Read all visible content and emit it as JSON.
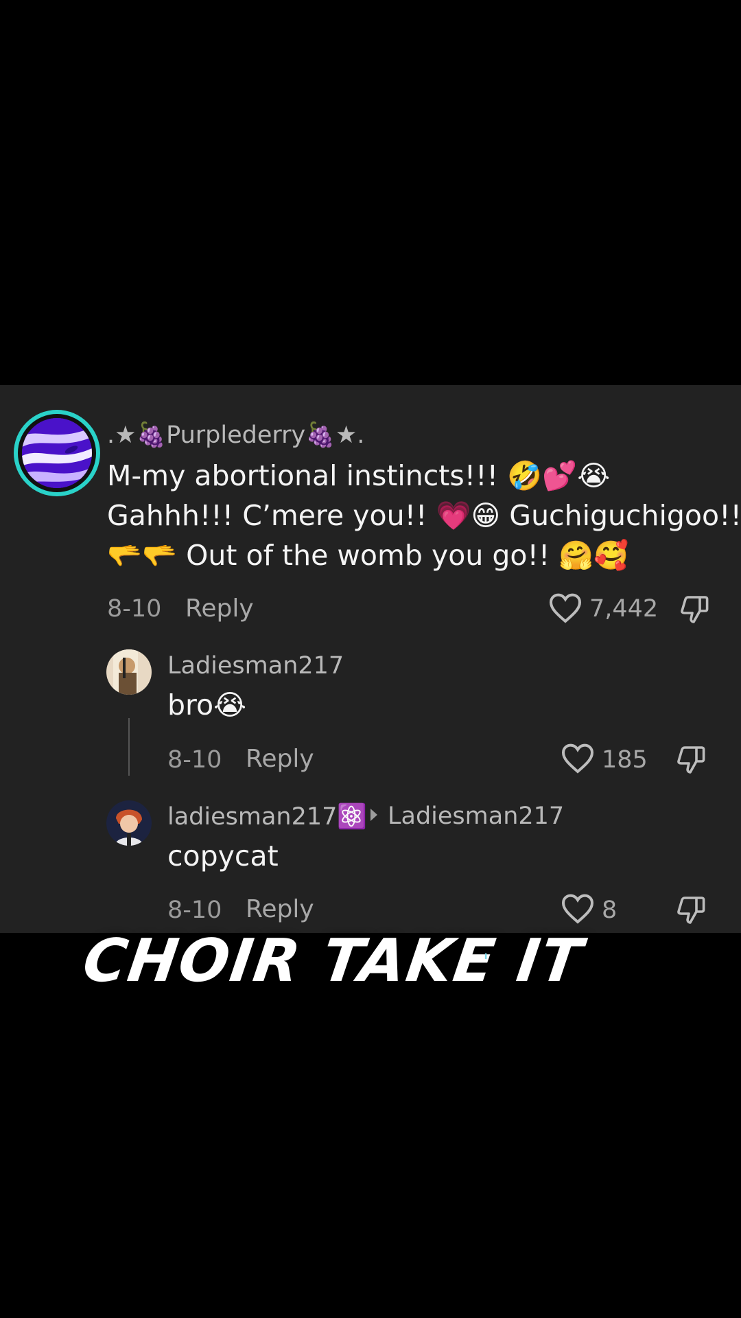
{
  "comment": {
    "username": ".★🍇Purplederry🍇★.",
    "lines": [
      "M-my abortional instincts!!! 🤣💕😭",
      "Gahhh!!! C’mere you!! 💗😁 Guchiguchigoo!!",
      "🫳🫳 Out of the womb you go!! 🤗🥰"
    ],
    "date": "8-10",
    "reply_label": "Reply",
    "likes": "7,442"
  },
  "replies": [
    {
      "username": "Ladiesman217",
      "text": "bro😭",
      "date": "8-10",
      "reply_label": "Reply",
      "likes": "185"
    },
    {
      "username": "ladiesman217⚛️",
      "reply_to": "Ladiesman217",
      "text": "copycat",
      "date": "8-10",
      "reply_label": "Reply",
      "likes": "8"
    }
  ],
  "caption": {
    "text": "CHOIR TAKE IT",
    "tick": "'"
  },
  "icons": {
    "like": "heart-outline-icon",
    "dislike": "thumbs-down-icon",
    "reply_arrow": "triangle-right-icon"
  },
  "colors": {
    "background": "#000000",
    "panel": "#222222",
    "avatar_ring": "#2ad2c9"
  }
}
